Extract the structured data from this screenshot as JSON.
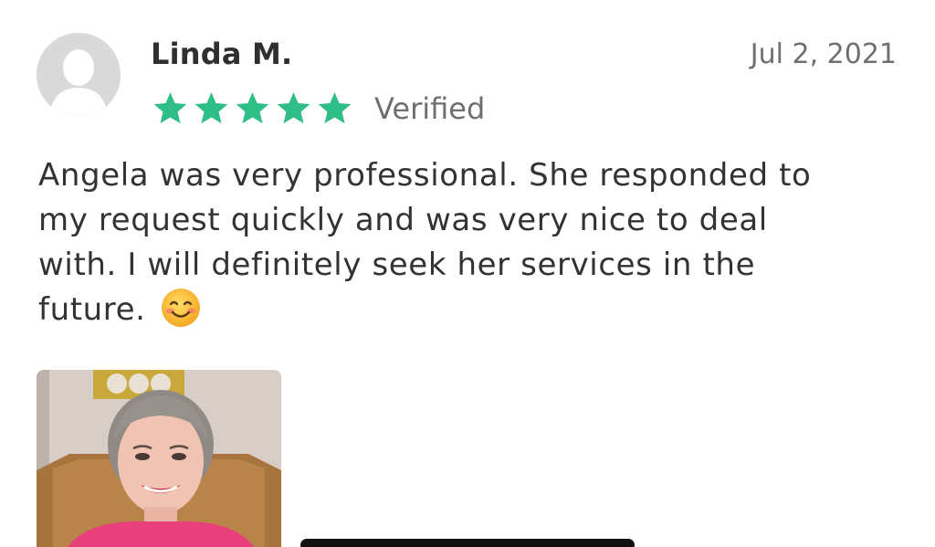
{
  "review": {
    "reviewer_name": "Linda M.",
    "date": "Jul 2, 2021",
    "rating": 5,
    "rating_max": 5,
    "verified_label": "Verified",
    "text": "Angela was very professional.  She responded to\nmy request quickly and was very nice to deal\nwith.  I will definitely seek her services in the\nfuture.",
    "emoji_icon": "smiling-face-emoji",
    "avatar_icon": "default-user-avatar",
    "attached_photo_icon": "reviewer-photo"
  },
  "colors": {
    "star": "#2fbe87",
    "avatar_bg": "#d9d9d9",
    "text": "#333333",
    "muted": "#6f6f6f"
  }
}
